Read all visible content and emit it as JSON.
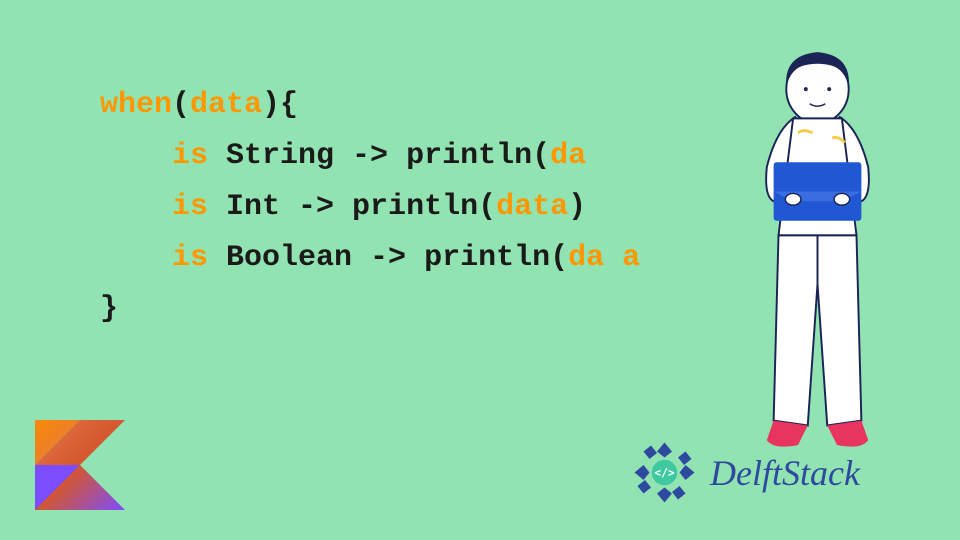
{
  "code": {
    "line1": {
      "kw1": "when",
      "p1": "(",
      "kw2": "data",
      "p2": "){"
    },
    "line2": {
      "indent": "    ",
      "kw1": "is",
      "t1": " String -> println(",
      "kw2": "da"
    },
    "line3": {
      "indent": "    ",
      "kw1": "is",
      "t1": " Int -> println(",
      "kw2": "data",
      "t2": ")"
    },
    "line4": {
      "indent": "    ",
      "kw1": "is",
      "t1": " Boolean -> println(",
      "kw2": "da a"
    },
    "line5": {
      "t1": "}"
    }
  },
  "brand": {
    "name": "DelftStack"
  },
  "colors": {
    "bg": "#92e3b2",
    "keyword": "#ff9800",
    "text": "#1a1a1a",
    "brand": "#2e4a9e"
  }
}
